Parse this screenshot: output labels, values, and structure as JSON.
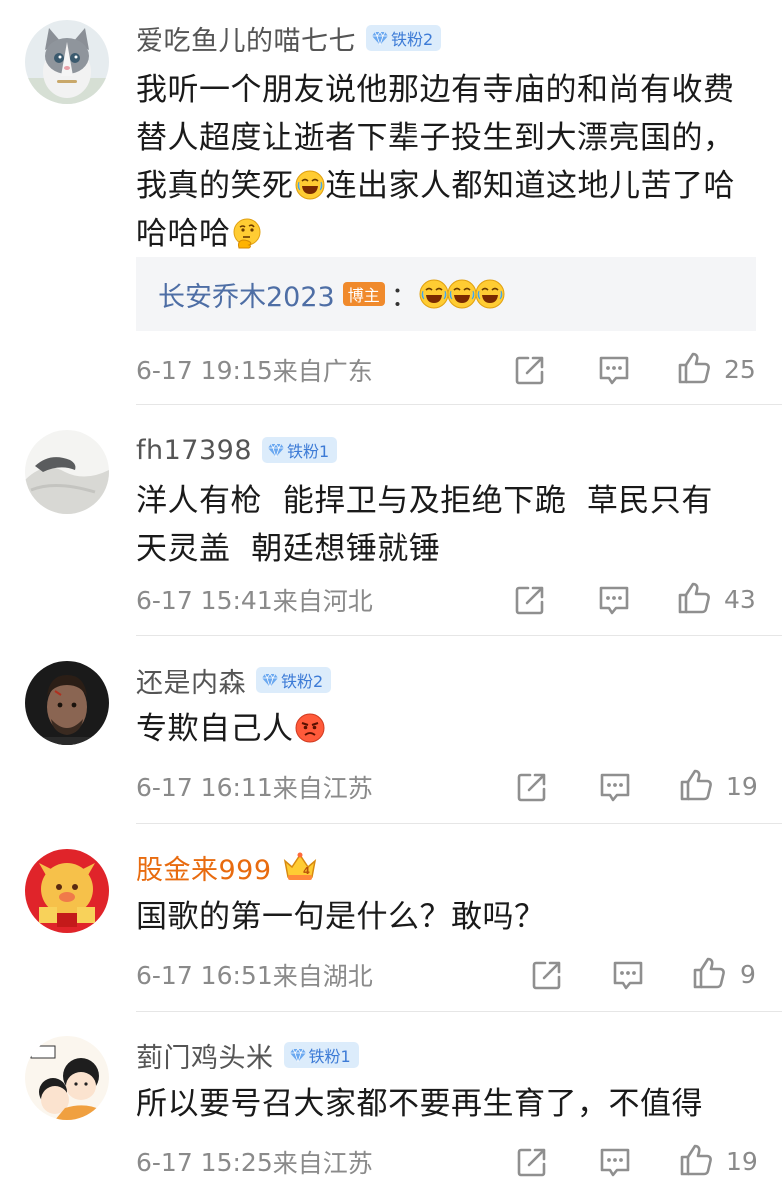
{
  "comments": [
    {
      "username": "爱吃鱼儿的喵七七",
      "badge": "铁粉2",
      "text_lines": [
        "我听一个朋友说他那边有寺庙的和尚有收费",
        "替人超度让逝者下辈子投生到大漂亮国的，",
        "我真的笑死",
        "连出家人都知道这地儿苦了哈",
        "哈哈哈"
      ],
      "reply": {
        "name": "长安乔木2023",
        "tag": "博主",
        "colon": "："
      },
      "time": "6-17 19:15",
      "location": "来自广东",
      "likes": "25"
    },
    {
      "username": "fh17398",
      "badge": "铁粉1",
      "text_lines": [
        "洋人有枪  能捍卫与及拒绝下跪  草民只有",
        "天灵盖  朝廷想锤就锤"
      ],
      "time": "6-17 15:41",
      "location": "来自河北",
      "likes": "43"
    },
    {
      "username": "还是内森",
      "badge": "铁粉2",
      "text_lines": [
        "专欺自己人"
      ],
      "time": "6-17 16:11",
      "location": "来自江苏",
      "likes": "19"
    },
    {
      "username": "股金来999",
      "text_lines": [
        "国歌的第一句是什么？敢吗？"
      ],
      "time": "6-17 16:51",
      "location": "来自湖北",
      "likes": "9"
    },
    {
      "username": "菿门鸡头米",
      "badge": "铁粉1",
      "text_lines": [
        "所以要号召大家都不要再生育了，不值得"
      ],
      "time": "6-17 15:25",
      "location": "来自江苏",
      "likes": "19"
    }
  ],
  "icons": {
    "share": "share-icon",
    "comment": "comment-icon",
    "like": "thumbs-up-icon",
    "badge_gem": "diamond-icon",
    "vip": "crown-icon"
  },
  "colors": {
    "username": "#555555",
    "vip_username": "#e86b0f",
    "badge_bg": "#dcecfb",
    "badge_text": "#3d7bd6",
    "reply_name": "#4e6ea5",
    "host_tag": "#f08a2c",
    "meta": "#8a8a8a"
  }
}
